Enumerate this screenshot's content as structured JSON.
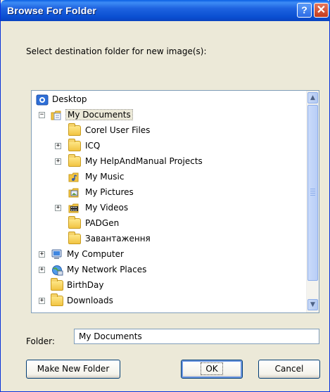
{
  "window": {
    "title": "Browse For Folder",
    "help_glyph": "?",
    "close_glyph": "✕"
  },
  "prompt": "Select destination folder for new image(s):",
  "tree": {
    "items": [
      {
        "label": "Desktop",
        "expander": "",
        "icon": "desktop-icon"
      },
      {
        "label": "My Documents",
        "expander": "−",
        "icon": "my-documents-icon",
        "selected": true
      },
      {
        "label": "Corel User Files",
        "expander": "",
        "icon": "folder-icon"
      },
      {
        "label": "ICQ",
        "expander": "+",
        "icon": "folder-icon"
      },
      {
        "label": "My HelpAndManual Projects",
        "expander": "+",
        "icon": "folder-icon"
      },
      {
        "label": "My Music",
        "expander": "",
        "icon": "music-folder-icon"
      },
      {
        "label": "My Pictures",
        "expander": "",
        "icon": "pictures-folder-icon"
      },
      {
        "label": "My Videos",
        "expander": "+",
        "icon": "videos-folder-icon"
      },
      {
        "label": "PADGen",
        "expander": "",
        "icon": "folder-icon"
      },
      {
        "label": "Завантаження",
        "expander": "",
        "icon": "folder-icon"
      },
      {
        "label": "My Computer",
        "expander": "+",
        "icon": "computer-icon"
      },
      {
        "label": "My Network Places",
        "expander": "+",
        "icon": "network-icon"
      },
      {
        "label": "BirthDay",
        "expander": "",
        "icon": "folder-icon"
      },
      {
        "label": "Downloads",
        "expander": "+",
        "icon": "folder-icon"
      }
    ],
    "scroll_up": "▲",
    "scroll_down": "▼"
  },
  "folder_field": {
    "label": "Folder:",
    "value": "My Documents"
  },
  "buttons": {
    "make_new_folder": "Make New Folder",
    "ok": "OK",
    "cancel": "Cancel"
  },
  "colors": {
    "title_bar": "#0a4fd1",
    "dialog_bg": "#ece9d8",
    "selection_bg": "#ece9d8"
  }
}
